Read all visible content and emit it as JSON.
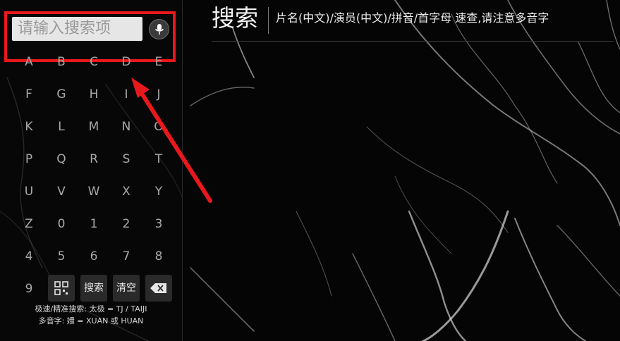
{
  "search": {
    "placeholder": "请输入搜索项",
    "mic_icon": "microphone-icon"
  },
  "keyboard": {
    "keys": [
      "A",
      "B",
      "C",
      "D",
      "E",
      "F",
      "G",
      "H",
      "I",
      "J",
      "K",
      "L",
      "M",
      "N",
      "O",
      "P",
      "Q",
      "R",
      "S",
      "T",
      "U",
      "V",
      "W",
      "X",
      "Y",
      "Z",
      "0",
      "1",
      "2",
      "3",
      "4",
      "5",
      "6",
      "7",
      "8",
      "9"
    ],
    "qr_icon": "qr-code-icon",
    "search_label": "搜索",
    "clear_label": "清空",
    "backspace_icon": "backspace-icon"
  },
  "hints": {
    "line1": "极速/精准搜索: 太极 = TJ / TAIJI",
    "line2": "多音字: 嬛 = XUAN 或 HUAN"
  },
  "header": {
    "title": "搜索",
    "subtitle": "片名(中文)/演员(中文)/拼音/首字母 速查,请注意多音字"
  },
  "colors": {
    "highlight": "#e8181c",
    "background": "#050505"
  }
}
